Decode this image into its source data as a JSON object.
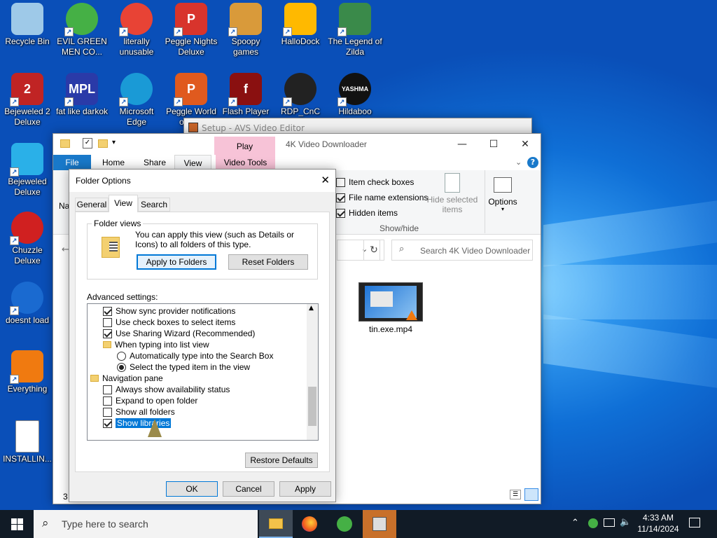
{
  "desktop": {
    "icons": [
      {
        "label": "Recycle Bin",
        "icon": "recycle-bin-icon",
        "color": "#9ec9e8"
      },
      {
        "label": "EVIL GREEN MEN CO...",
        "icon": "green-men-icon",
        "color": "#45b045"
      },
      {
        "label": "literally unusable",
        "icon": "chrome-icon",
        "color": "#e84335"
      },
      {
        "label": "Peggle Nights Deluxe",
        "icon": "peggle-nights-icon",
        "color": "#d8342c"
      },
      {
        "label": "Spoopy games",
        "icon": "game-folder-icon",
        "color": "#d99a3a"
      },
      {
        "label": "HalloDock",
        "icon": "shield-icon",
        "color": "#ffb900"
      },
      {
        "label": "The Legend of Zilda",
        "icon": "zilda-icon",
        "color": "#3a8a4a"
      },
      {
        "label": "Bejeweled 2 Deluxe",
        "icon": "bejeweled-2-icon",
        "color": "#c02424"
      },
      {
        "label": "fat like darkok",
        "icon": "mpl-icon",
        "color": "#2a3aa8"
      },
      {
        "label": "Microsoft Edge",
        "icon": "edge-icon",
        "color": "#1a9ad6"
      },
      {
        "label": "Peggle World of W...",
        "icon": "peggle-world-icon",
        "color": "#e05a1e"
      },
      {
        "label": "Flash Player",
        "icon": "flash-icon",
        "color": "#8a1010"
      },
      {
        "label": "RDP_CnC",
        "icon": "rdp-icon",
        "color": "#222222"
      },
      {
        "label": "Hildaboo",
        "icon": "yashma-icon",
        "color": "#111111"
      },
      {
        "label": "Bejeweled Deluxe",
        "icon": "bejeweled-icon",
        "color": "#2ab0e8"
      },
      {
        "label": "Chuzzle Deluxe",
        "icon": "chuzzle-icon",
        "color": "#d02020"
      },
      {
        "label": "doesnt load",
        "icon": "thunderbird-icon",
        "color": "#1a6ad0"
      },
      {
        "label": "Everything",
        "icon": "magnifier-icon",
        "color": "#f07a10"
      },
      {
        "label": "INSTALLIN...",
        "icon": "text-file-icon",
        "color": "#ffffff"
      }
    ],
    "icon_glyphs": {
      "bejeweled-2-icon": "2",
      "mpl-icon": "MPL",
      "peggle-nights-icon": "P",
      "peggle-world-icon": "P",
      "flash-icon": "f",
      "yashma-icon": "YASHMA",
      "chrome-icon": "",
      "text-file-icon": ""
    }
  },
  "setup_window": {
    "title": "Setup - AVS Video Editor"
  },
  "explorer": {
    "title": "4K Video Downloader",
    "ribbon_play": "Play",
    "tabs": [
      "File",
      "Home",
      "Share",
      "View",
      "Video Tools"
    ],
    "show_hide": {
      "item_check_boxes": "Item check boxes",
      "file_name_extensions": "File name extensions",
      "hidden_items": "Hidden items",
      "hide_selected": "Hide selected items",
      "group": "Show/hide",
      "options": "Options"
    },
    "nav_partial": "Na",
    "search_placeholder": "Search 4K Video Downloader",
    "file": {
      "name": "tin.exe.mp4"
    },
    "status_partial": "3"
  },
  "dialog": {
    "title": "Folder Options",
    "tabs": [
      "General",
      "View",
      "Search"
    ],
    "folder_views": {
      "legend": "Folder views",
      "description": "You can apply this view (such as Details or Icons) to all folders of this type.",
      "apply_button": "Apply to Folders",
      "reset_button": "Reset Folders"
    },
    "advanced_label": "Advanced settings:",
    "settings": [
      {
        "kind": "check",
        "checked": true,
        "label": "Show sync provider notifications"
      },
      {
        "kind": "check",
        "checked": false,
        "label": "Use check boxes to select items"
      },
      {
        "kind": "check",
        "checked": true,
        "label": "Use Sharing Wizard (Recommended)"
      },
      {
        "kind": "folder",
        "label": "When typing into list view"
      },
      {
        "kind": "radio",
        "checked": false,
        "label": "Automatically type into the Search Box"
      },
      {
        "kind": "radio",
        "checked": true,
        "label": "Select the typed item in the view"
      },
      {
        "kind": "navfolder",
        "label": "Navigation pane"
      },
      {
        "kind": "check",
        "checked": false,
        "label": "Always show availability status"
      },
      {
        "kind": "check",
        "checked": false,
        "label": "Expand to open folder"
      },
      {
        "kind": "check",
        "checked": false,
        "label": "Show all folders"
      },
      {
        "kind": "check",
        "checked": true,
        "label": "Show libraries",
        "selected": true
      }
    ],
    "restore_button": "Restore Defaults",
    "ok": "OK",
    "cancel": "Cancel",
    "apply": "Apply"
  },
  "taskbar": {
    "search_placeholder": "Type here to search",
    "time": "4:33 AM",
    "date": "11/14/2024"
  },
  "colors": {
    "accent": "#0078d7",
    "ribbon_file": "#1979ca",
    "play_tab": "#f7c3d7",
    "selection": "#0078d7",
    "taskbar": "#111b26"
  }
}
